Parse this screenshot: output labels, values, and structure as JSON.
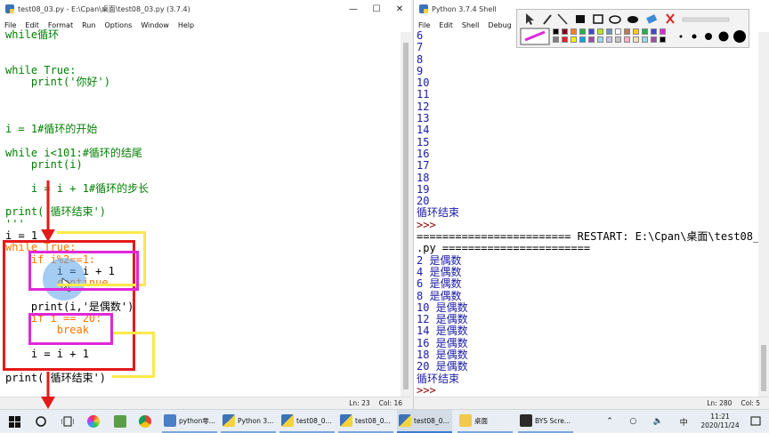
{
  "editor": {
    "title": "test08_03.py - E:\\Cpan\\桌面\\test08_03.py (3.7.4)",
    "menu": [
      "File",
      "Edit",
      "Format",
      "Run",
      "Options",
      "Window",
      "Help"
    ],
    "lines": [
      {
        "text": "while循环",
        "color": "#008000"
      },
      {
        "text": "",
        "color": "#000"
      },
      {
        "text": "",
        "color": "#000"
      },
      {
        "text": "while True:",
        "color": "#008000"
      },
      {
        "text": "    print('你好')",
        "color": "#008000"
      },
      {
        "text": "",
        "color": "#000"
      },
      {
        "text": "",
        "color": "#000"
      },
      {
        "text": "",
        "color": "#000"
      },
      {
        "text": "i = 1#循环的开始",
        "color": "#008000"
      },
      {
        "text": "",
        "color": "#000"
      },
      {
        "text": "while i<101:#循环的结尾",
        "color": "#008000"
      },
      {
        "text": "    print(i)",
        "color": "#008000"
      },
      {
        "text": "",
        "color": "#000"
      },
      {
        "text": "    i = i + 1#循环的步长",
        "color": "#008000"
      },
      {
        "text": "",
        "color": "#000"
      },
      {
        "text": "print('循环结束')",
        "color": "#008000"
      },
      {
        "text": "'''",
        "color": "#008000"
      },
      {
        "text": "i = 1",
        "color": "#000000"
      },
      {
        "text": "while True:",
        "color": "#ff7700"
      },
      {
        "text": "    if i%2==1:",
        "color": "#ff7700"
      },
      {
        "text": "        i = i + 1",
        "color": "#000000"
      },
      {
        "text": "        continue",
        "color": "#ff7700"
      },
      {
        "text": "",
        "color": "#000"
      },
      {
        "text": "    print(i,'是偶数')",
        "color": "#000000"
      },
      {
        "text": "    if i == 20:",
        "color": "#ff7700"
      },
      {
        "text": "        break",
        "color": "#ff7700"
      },
      {
        "text": "",
        "color": "#000"
      },
      {
        "text": "    i = i + 1",
        "color": "#000000"
      },
      {
        "text": "",
        "color": "#000"
      },
      {
        "text": "print('循环结束')",
        "color": "#000000"
      }
    ],
    "status_line": "Ln: 23",
    "status_col": "Col: 16"
  },
  "shell": {
    "title": "Python 3.7.4 Shell",
    "menu": [
      "File",
      "Edit",
      "Shell",
      "Debug",
      "Op"
    ],
    "lines": [
      {
        "text": "6",
        "color": "#1a1aa6"
      },
      {
        "text": "7",
        "color": "#1a1aa6"
      },
      {
        "text": "8",
        "color": "#1a1aa6"
      },
      {
        "text": "9",
        "color": "#1a1aa6"
      },
      {
        "text": "10",
        "color": "#1a1aa6"
      },
      {
        "text": "11",
        "color": "#1a1aa6"
      },
      {
        "text": "12",
        "color": "#1a1aa6"
      },
      {
        "text": "13",
        "color": "#1a1aa6"
      },
      {
        "text": "14",
        "color": "#1a1aa6"
      },
      {
        "text": "15",
        "color": "#1a1aa6"
      },
      {
        "text": "16",
        "color": "#1a1aa6"
      },
      {
        "text": "17",
        "color": "#1a1aa6"
      },
      {
        "text": "18",
        "color": "#1a1aa6"
      },
      {
        "text": "19",
        "color": "#1a1aa6"
      },
      {
        "text": "20",
        "color": "#1a1aa6"
      },
      {
        "text": "循环结束",
        "color": "#1a1aa6"
      },
      {
        "text": ">>> ",
        "color": "#8b0000"
      },
      {
        "text": "======================== RESTART: E:\\Cpan\\桌面\\test08_03",
        "color": "#000000"
      },
      {
        "text": ".py =======================",
        "color": "#000000"
      },
      {
        "text": "2 是偶数",
        "color": "#1a1aa6"
      },
      {
        "text": "4 是偶数",
        "color": "#1a1aa6"
      },
      {
        "text": "6 是偶数",
        "color": "#1a1aa6"
      },
      {
        "text": "8 是偶数",
        "color": "#1a1aa6"
      },
      {
        "text": "10 是偶数",
        "color": "#1a1aa6"
      },
      {
        "text": "12 是偶数",
        "color": "#1a1aa6"
      },
      {
        "text": "14 是偶数",
        "color": "#1a1aa6"
      },
      {
        "text": "16 是偶数",
        "color": "#1a1aa6"
      },
      {
        "text": "18 是偶数",
        "color": "#1a1aa6"
      },
      {
        "text": "20 是偶数",
        "color": "#1a1aa6"
      },
      {
        "text": "循环结束",
        "color": "#1a1aa6"
      },
      {
        "text": ">>> ",
        "color": "#8b0000"
      }
    ],
    "status_line": "Ln: 280",
    "status_col": "Col: 5"
  },
  "taskbar": {
    "items": [
      "python零...",
      "Python 3...",
      "test08_0...",
      "test08_0...",
      "test08_0...",
      "桌面",
      "BYS Scre..."
    ],
    "clock_time": "11:21",
    "clock_date": "2020/11/24",
    "lang": "中"
  },
  "colors": {
    "annotation_red": "#e31a1a",
    "annotation_yellow": "#ffe84a",
    "annotation_magenta": "#e127d9"
  }
}
